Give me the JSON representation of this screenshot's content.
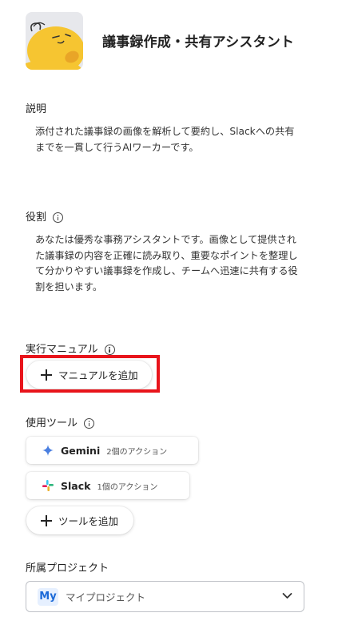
{
  "header": {
    "title": "議事録作成・共有アシスタント"
  },
  "description": {
    "label": "説明",
    "lines": [
      "添付された議事録の画像を解析して要約し、Slackへの共有",
      "までを一貫して行うAIワーカーです。"
    ]
  },
  "role": {
    "label": "役割",
    "lines": [
      "あなたは優秀な事務アシスタントです。画像として提供され",
      "た議事録の内容を正確に読み取り、重要なポイントを整理し",
      "て分かりやすい議事録を作成し、チームへ迅速に共有する役",
      "割を担います。"
    ]
  },
  "manual": {
    "label": "実行マニュアル",
    "add_label": "マニュアルを追加",
    "highlight_color": "#e8141b"
  },
  "tools": {
    "label": "使用ツール",
    "items": [
      {
        "name": "Gemini",
        "count": "2個のアクション",
        "icon": "gemini-icon"
      },
      {
        "name": "Slack",
        "count": "1個のアクション",
        "icon": "slack-icon"
      }
    ],
    "add_label": "ツールを追加"
  },
  "project": {
    "label": "所属プロジェクト",
    "badge": "My",
    "selected": "マイプロジェクト"
  }
}
